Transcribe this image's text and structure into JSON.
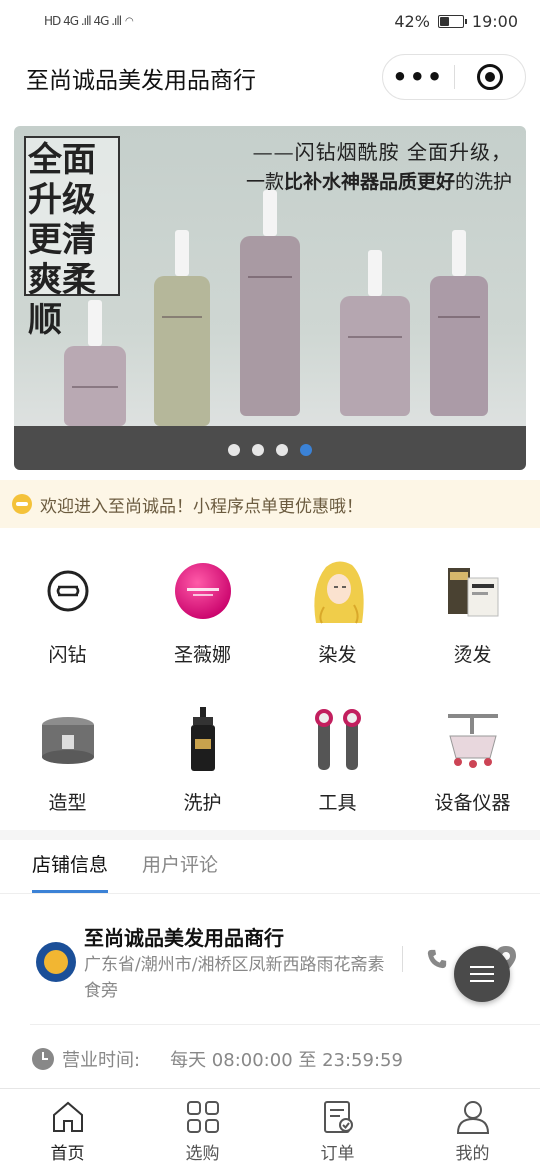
{
  "status_bar": {
    "left": "HD 4G .ıll 4G .ıll",
    "battery": "42%",
    "battery_level": 0.42,
    "time": "19:00"
  },
  "nav": {
    "title": "至尚诚品美发用品商行",
    "more_label": "•••"
  },
  "banner": {
    "slogan": "全面升级更清爽柔顺",
    "headline_line1": "——闪钻烟酰胺 全面升级，",
    "headline_line2_a": "一款",
    "headline_line2_b": "比补水神器品质更好",
    "headline_line2_c": "的洗护",
    "slide_count": 4,
    "active_slide": 4
  },
  "notice": {
    "text": "欢迎进入至尚诚品！小程序点单更优惠哦！"
  },
  "categories": [
    {
      "label": "闪钻",
      "icon": "shanzuan-logo-icon"
    },
    {
      "label": "圣薇娜",
      "icon": "shengweina-logo-icon"
    },
    {
      "label": "染发",
      "icon": "hair-dye-icon"
    },
    {
      "label": "烫发",
      "icon": "perm-product-icon"
    },
    {
      "label": "造型",
      "icon": "styling-wax-icon"
    },
    {
      "label": "洗护",
      "icon": "shampoo-bottle-icon"
    },
    {
      "label": "工具",
      "icon": "hair-dryer-icon"
    },
    {
      "label": "设备仪器",
      "icon": "salon-equipment-icon"
    }
  ],
  "tabs": [
    {
      "label": "店铺信息",
      "active": true
    },
    {
      "label": "用户评论",
      "active": false
    }
  ],
  "store": {
    "name": "至尚诚品美发用品商行",
    "address": "广东省/潮州市/湘桥区凤新西路雨花斋素食旁",
    "hours_label": "营业时间:",
    "hours_value": "每天 08:00:00 至 23:59:59"
  },
  "tabbar": [
    {
      "label": "首页",
      "icon": "home-icon",
      "active": true
    },
    {
      "label": "选购",
      "icon": "grid-icon",
      "active": false
    },
    {
      "label": "订单",
      "icon": "order-icon",
      "active": false
    },
    {
      "label": "我的",
      "icon": "user-icon",
      "active": false
    }
  ],
  "colors": {
    "accent": "#3b82d6",
    "notice_bg": "#fdf6e6",
    "notice_icon": "#f4c23a"
  }
}
